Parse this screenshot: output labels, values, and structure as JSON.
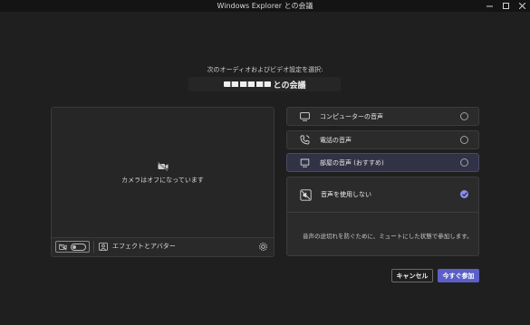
{
  "window": {
    "title": "Windows Explorer との会議"
  },
  "prompt": "次のオーディオおよびビデオ設定を選択:",
  "meeting": {
    "title_suffix": "との会議"
  },
  "video": {
    "camera_status": "カメラはオフになっています",
    "effects_label": "エフェクトとアバター",
    "camera_on": false
  },
  "audio": {
    "options": [
      {
        "label": "コンピューターの音声",
        "icon": "monitor-icon",
        "selected": false
      },
      {
        "label": "電話の音声",
        "icon": "phone-icon",
        "selected": false
      },
      {
        "label": "部屋の音声 (おすすめ)",
        "icon": "room-icon",
        "selected": true
      }
    ],
    "no_audio": {
      "label": "音声を使用しない",
      "icon": "speaker-off-icon",
      "checked": true,
      "description": "音声の途切れを防ぐために、ミュートにした状態で参加します。"
    }
  },
  "actions": {
    "cancel": "キャンセル",
    "join": "今すぐ参加"
  },
  "colors": {
    "background": "#1f1f1f",
    "accent": "#5b5fc7",
    "check": "#8b8cf0"
  }
}
